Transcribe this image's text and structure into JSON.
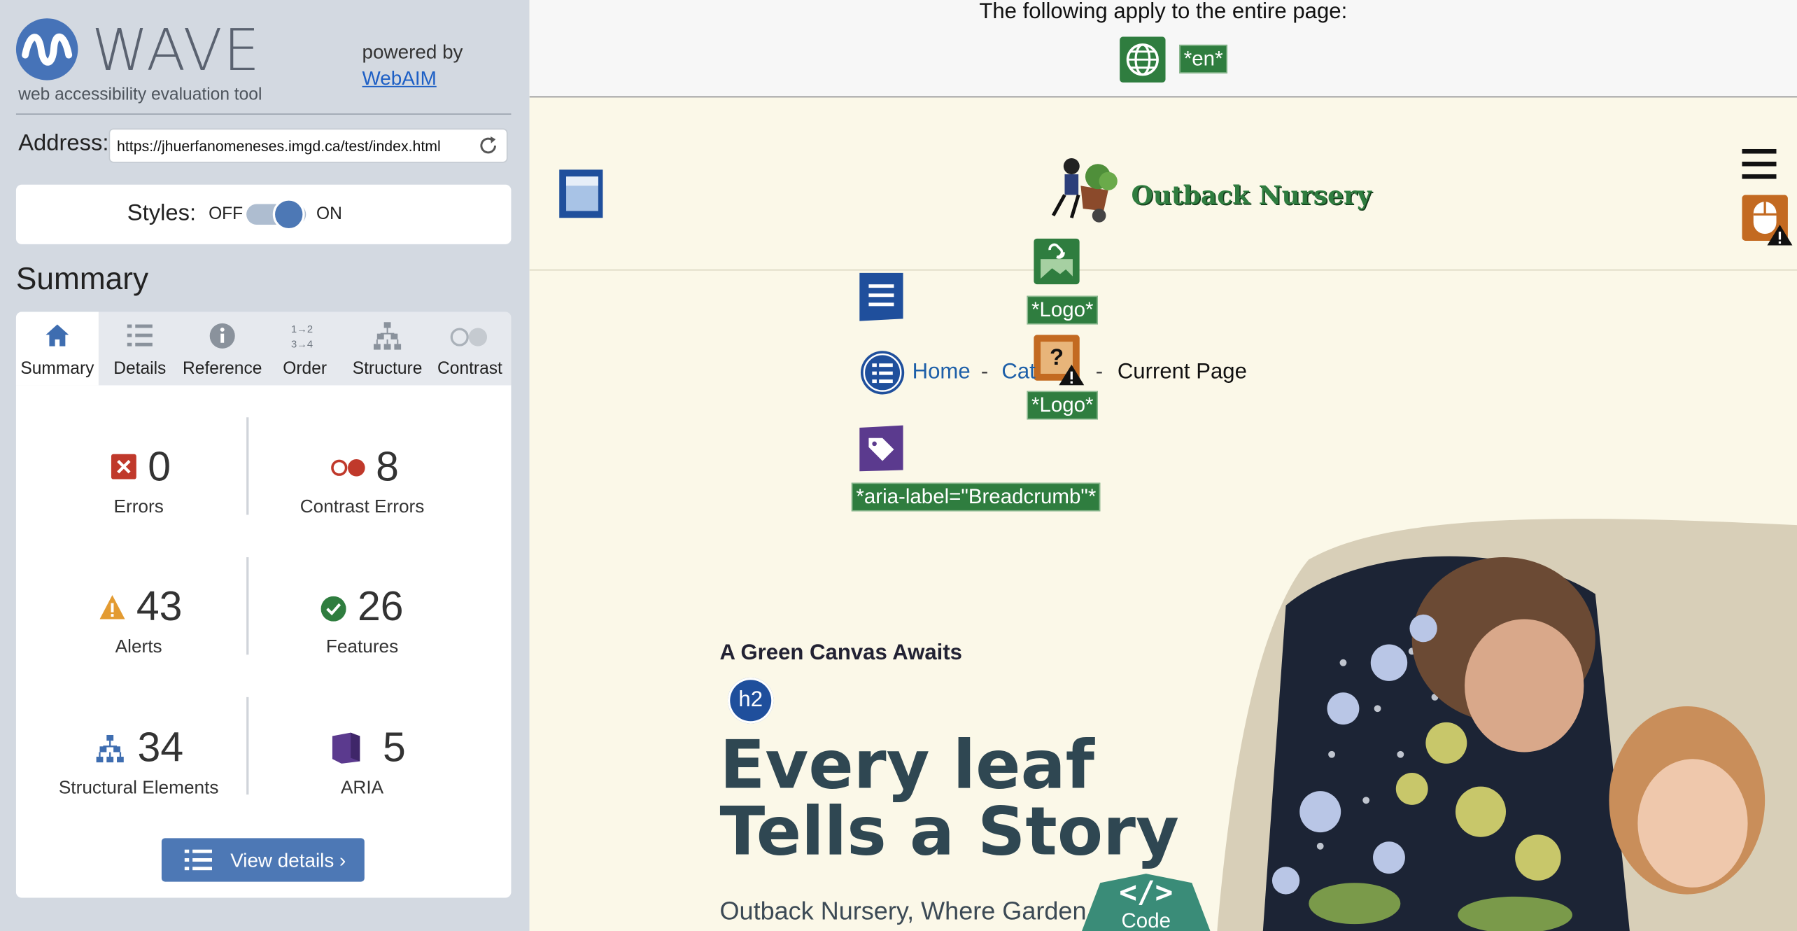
{
  "app": {
    "logo_word": "WAVE",
    "tagline": "web accessibility evaluation tool",
    "powered_by": "powered by",
    "powered_link": "WebAIM"
  },
  "address": {
    "label": "Address:",
    "value": "https://jhuerfanomeneses.imgd.ca/test/index.html"
  },
  "styles": {
    "label": "Styles:",
    "off": "OFF",
    "on": "ON",
    "enabled": true
  },
  "summary": {
    "heading": "Summary",
    "tabs": [
      {
        "label": "Summary",
        "icon": "home-icon",
        "active": true
      },
      {
        "label": "Details",
        "icon": "list-icon"
      },
      {
        "label": "Reference",
        "icon": "info-icon"
      },
      {
        "label": "Order",
        "icon": "order-icon"
      },
      {
        "label": "Structure",
        "icon": "structure-icon"
      },
      {
        "label": "Contrast",
        "icon": "contrast-icon"
      }
    ],
    "stats": {
      "errors": {
        "value": "0",
        "label": "Errors"
      },
      "contrast_errors": {
        "value": "8",
        "label": "Contrast Errors"
      },
      "alerts": {
        "value": "43",
        "label": "Alerts"
      },
      "features": {
        "value": "26",
        "label": "Features"
      },
      "structural": {
        "value": "34",
        "label": "Structural Elements"
      },
      "aria": {
        "value": "5",
        "label": "ARIA"
      }
    },
    "view_details": "View details ›"
  },
  "content": {
    "topbar_text": "The following apply to the entire page:",
    "lang_tag": "*en*",
    "brand_name": "Outback Nursery",
    "logo_tag_1": "*Logo*",
    "logo_tag_2": "*Logo*",
    "aria_label_tag": "*aria-label=\"Breadcrumb\"*",
    "breadcrumb": {
      "home": "Home",
      "cat": "Cat",
      "sep": "-",
      "current": "Current Page"
    },
    "h2_badge": "h2",
    "eyebrow": "A Green Canvas Awaits",
    "hero_line_1": "Every leaf",
    "hero_line_2": "Tells a Story",
    "hero_sub": "Outback Nursery, Where Garden",
    "code_badge": "Code",
    "code_badge_glyph": "</>"
  },
  "colors": {
    "sidebar_bg": "#d3d9e1",
    "accent_blue": "#4d78b5",
    "page_bg": "#fbf8e8",
    "feature_green": "#2f7d3f",
    "error_red": "#c0392b",
    "alert_orange": "#e39b32",
    "aria_purple": "#5b3a8e"
  }
}
